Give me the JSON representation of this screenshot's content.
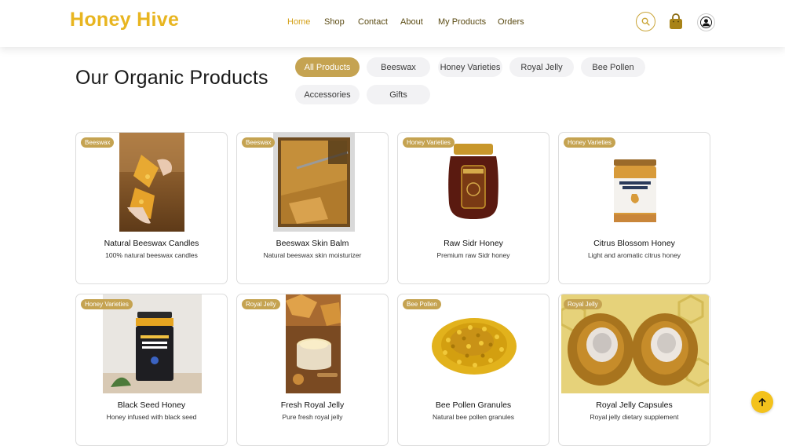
{
  "brand": {
    "name": "Honey Hive",
    "color": "#e8b520"
  },
  "nav": {
    "items": [
      {
        "label": "Home",
        "active": true
      },
      {
        "label": "Shop"
      },
      {
        "label": "Contact"
      },
      {
        "label": "About"
      },
      {
        "label": "My Products"
      },
      {
        "label": "Orders"
      }
    ]
  },
  "header_icons": {
    "search": "search-icon",
    "cart": "shopping-bag-icon",
    "account": "user-avatar-icon"
  },
  "page": {
    "title": "Our Organic Products"
  },
  "filters": [
    {
      "label": "All Products",
      "active": true
    },
    {
      "label": "Beeswax"
    },
    {
      "label": "Honey Varieties"
    },
    {
      "label": "Royal Jelly"
    },
    {
      "label": "Bee Pollen"
    },
    {
      "label": "Accessories"
    },
    {
      "label": "Gifts"
    }
  ],
  "products": [
    {
      "category": "Beeswax",
      "name": "Natural Beeswax Candles",
      "description": "100% natural beeswax candles"
    },
    {
      "category": "Beeswax",
      "name": "Beeswax Skin Balm",
      "description": "Natural beeswax skin moisturizer"
    },
    {
      "category": "Honey Varieties",
      "name": "Raw Sidr Honey",
      "description": "Premium raw Sidr honey"
    },
    {
      "category": "Honey Varieties",
      "name": "Citrus Blossom Honey",
      "description": "Light and aromatic citrus honey"
    },
    {
      "category": "Honey Varieties",
      "name": "Black Seed Honey",
      "description": "Honey infused with black seed"
    },
    {
      "category": "Royal Jelly",
      "name": "Fresh Royal Jelly",
      "description": "Pure fresh royal jelly"
    },
    {
      "category": "Bee Pollen",
      "name": "Bee Pollen Granules",
      "description": "Natural bee pollen granules"
    },
    {
      "category": "Royal Jelly",
      "name": "Royal Jelly Capsules",
      "description": "Royal jelly dietary supplement"
    }
  ],
  "colors": {
    "accent": "#c5a351",
    "scroll_button": "#f3c21c"
  }
}
